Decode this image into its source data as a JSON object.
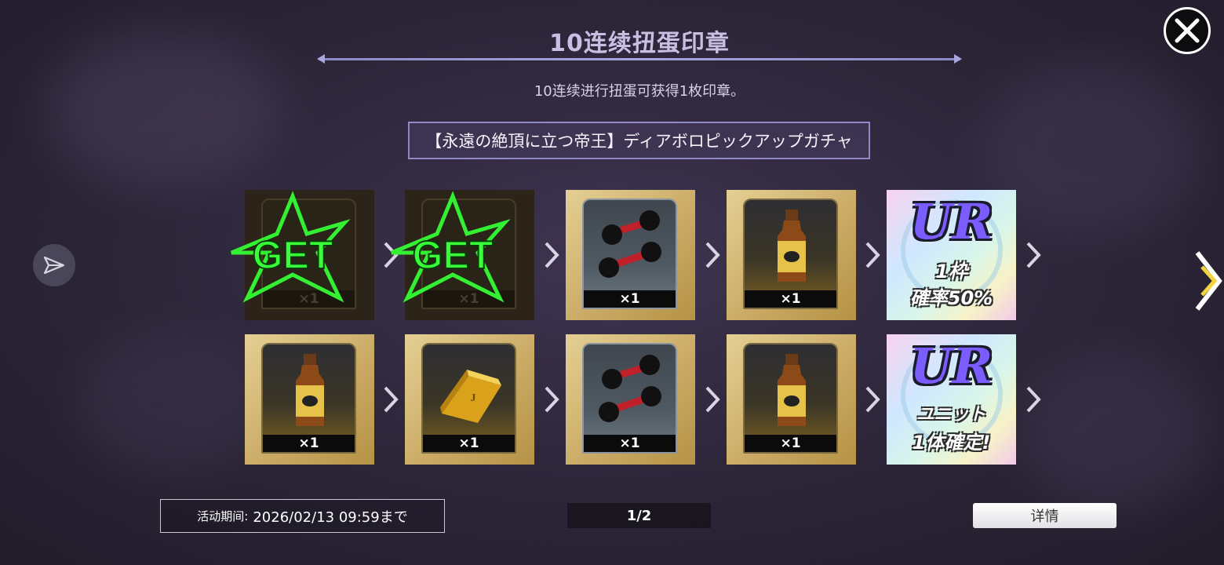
{
  "header": {
    "title": "10连续扭蛋印章",
    "subtitle": "10连续进行扭蛋可获得1枚印章。",
    "gacha_name": "【永遠の絶頂に立つ帝王】ディアボロピックアップガチャ"
  },
  "stamps": [
    {
      "slot": 1,
      "item": "get-stamp",
      "stamp_label": "GET",
      "qty": "×1",
      "collected": true
    },
    {
      "slot": 2,
      "item": "get-stamp",
      "stamp_label": "GET",
      "qty": "×1",
      "collected": true
    },
    {
      "slot": 3,
      "item": "dumbbell",
      "qty": "×1",
      "collected": false
    },
    {
      "slot": 4,
      "item": "energy-drink",
      "qty": "×1",
      "collected": false
    },
    {
      "slot": 5,
      "item": "ur-ticket",
      "ur_logo": "UR",
      "line1": "1枠",
      "line2": "確率50%",
      "collected": false
    },
    {
      "slot": 6,
      "item": "energy-drink",
      "qty": "×1",
      "collected": false
    },
    {
      "slot": 7,
      "item": "gold-bar",
      "qty": "×1",
      "collected": false
    },
    {
      "slot": 8,
      "item": "dumbbell",
      "qty": "×1",
      "collected": false
    },
    {
      "slot": 9,
      "item": "energy-drink",
      "qty": "×1",
      "collected": false
    },
    {
      "slot": 10,
      "item": "ur-ticket",
      "ur_logo": "UR",
      "line1": "ユニット",
      "line2": "1体確定!",
      "collected": false
    }
  ],
  "footer": {
    "period_label": "活动期间:",
    "period_value": "2026/02/13 09:59まで",
    "page_indicator": "1/2",
    "detail_button": "详情"
  },
  "colors": {
    "accent": "#a9a4de",
    "tile_gold": "#c8a862",
    "get_green": "#3cff3c"
  },
  "icons": [
    "close-icon",
    "share-icon",
    "next-page-icon",
    "chevron-right-icon"
  ]
}
